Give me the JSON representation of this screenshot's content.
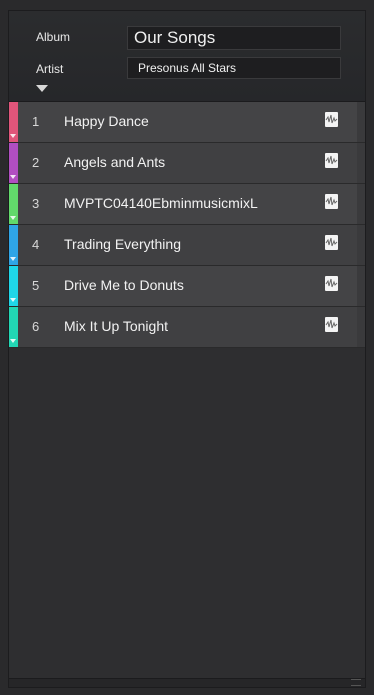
{
  "header": {
    "album_label": "Album",
    "album_value": "Our Songs",
    "artist_label": "Artist",
    "artist_value": "Presonus All Stars"
  },
  "tracks": [
    {
      "number": "1",
      "title": "Happy Dance",
      "color": "#e0557a"
    },
    {
      "number": "2",
      "title": "Angels and Ants",
      "color": "#b14ec1"
    },
    {
      "number": "3",
      "title": "MVPTC04140EbminmusicmixL",
      "color": "#62d96b"
    },
    {
      "number": "4",
      "title": "Trading Everything",
      "color": "#2fa5e6"
    },
    {
      "number": "5",
      "title": "Drive Me to Donuts",
      "color": "#1fd6e8"
    },
    {
      "number": "6",
      "title": "Mix It Up Tonight",
      "color": "#22d6b4"
    }
  ],
  "icons": {
    "expand": "triangle-down-icon",
    "track_audio": "waveform-icon"
  }
}
